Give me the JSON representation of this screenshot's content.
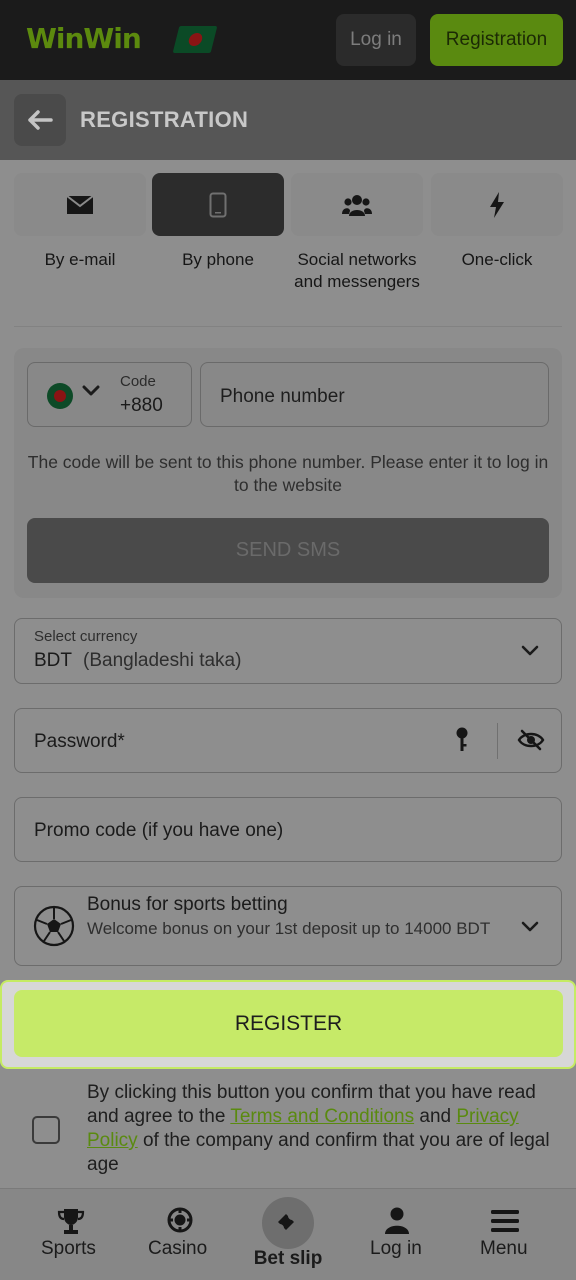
{
  "header": {
    "logo_text": "WinWin",
    "login_label": "Log in",
    "registration_label": "Registration"
  },
  "titlebar": {
    "title": "REGISTRATION"
  },
  "tabs": [
    {
      "label": "By e-mail",
      "icon": "envelope-icon",
      "active": false
    },
    {
      "label": "By phone",
      "icon": "phone-icon",
      "active": true
    },
    {
      "label": "Social networks and messengers",
      "icon": "people-icon",
      "active": false
    },
    {
      "label": "One-click",
      "icon": "lightning-icon",
      "active": false
    }
  ],
  "phone_form": {
    "code_label": "Code",
    "code_value": "+880",
    "phone_placeholder": "Phone number",
    "hint": "The code will be sent to this phone number. Please enter it to log in to the website",
    "send_sms_label": "SEND SMS"
  },
  "currency": {
    "label": "Select currency",
    "code": "BDT",
    "name": "(Bangladeshi taka)"
  },
  "password": {
    "placeholder": "Password*"
  },
  "promo": {
    "placeholder": "Promo code (if you have one)"
  },
  "bonus": {
    "title": "Bonus for sports betting",
    "description": "Welcome bonus on your 1st deposit up to 14000 BDT"
  },
  "register": {
    "label": "REGISTER"
  },
  "terms": {
    "part1": "By clicking this button you confirm that you have read and agree to the ",
    "terms_link": "Terms and Conditions",
    "part2": " and ",
    "privacy_link": "Privacy Policy",
    "part3": " of the company and confirm that you are of legal age"
  },
  "bottom_nav": {
    "sports": "Sports",
    "casino": "Casino",
    "bet_slip": "Bet slip",
    "login": "Log in",
    "menu": "Menu"
  },
  "colors": {
    "accent": "#c6ea68",
    "link": "#5a8a10",
    "header_bg": "#1b1b1b"
  }
}
